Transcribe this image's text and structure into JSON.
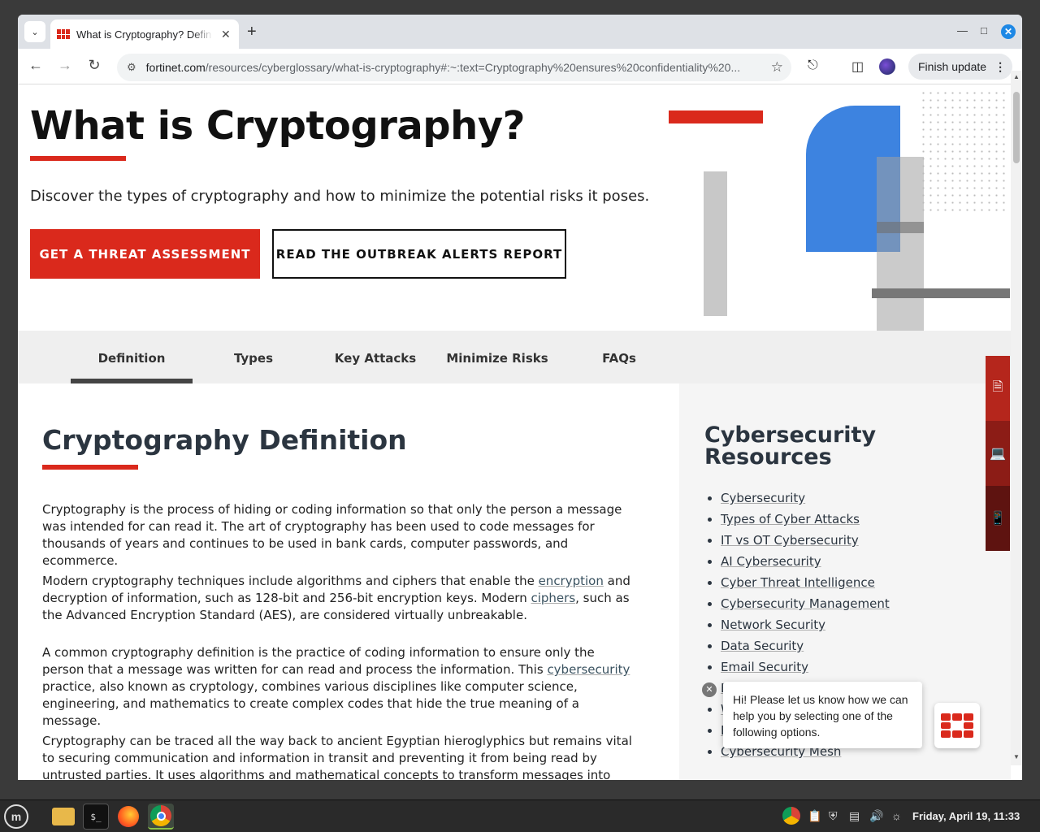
{
  "browser": {
    "tab_title": "What is Cryptography? Defin",
    "url_host": "fortinet.com",
    "url_path": "/resources/cyberglossary/what-is-cryptography#:~:text=Cryptography%20ensures%20confidentiality%20...",
    "finish_update_label": "Finish update"
  },
  "hero": {
    "title": "What is Cryptography?",
    "subtitle": "Discover the types of cryptography and how to minimize the potential risks it poses.",
    "primary_button": "GET A THREAT ASSESSMENT",
    "secondary_button": "READ THE OUTBREAK ALERTS REPORT"
  },
  "tabs": [
    {
      "label": "Definition"
    },
    {
      "label": "Types"
    },
    {
      "label": "Key Attacks"
    },
    {
      "label": "Minimize Risks"
    },
    {
      "label": "FAQs"
    }
  ],
  "section": {
    "title": "Cryptography Definition",
    "p1": "Cryptography is the process of hiding or coding information so that only the person a message was intended for can read it. The art of cryptography has been used to code messages for thousands of years and continues to be used in bank cards, computer passwords, and ecommerce.",
    "p2_a": "Modern cryptography techniques include algorithms and ciphers that enable the ",
    "p2_link1": "encryption",
    "p2_b": " and decryption of information, such as 128-bit and 256-bit encryption keys. Modern ",
    "p2_link2": "ciphers",
    "p2_c": ", such as the Advanced Encryption Standard (AES), are considered virtually unbreakable.",
    "p3_a": "A common cryptography definition is the practice of coding information to ensure only the person that a message was written for can read and process the information. This ",
    "p3_link": "cybersecurity",
    "p3_b": " practice, also known as cryptology, combines various disciplines like computer science, engineering, and mathematics to create complex codes that hide the true meaning of a message.",
    "p4": "Cryptography can be traced all the way back to ancient Egyptian hieroglyphics but remains vital to securing communication and information in transit and preventing it from being read by untrusted parties. It uses algorithms and mathematical concepts to transform messages into difficult-to-decipher"
  },
  "resources": {
    "title_line1": "Cybersecurity",
    "title_line2": "Resources",
    "items": [
      "Cybersecurity",
      "Types of Cyber Attacks",
      "IT vs OT Cybersecurity",
      "AI Cybersecurity",
      "Cyber Threat Intelligence",
      "Cybersecurity Management",
      "Network Security",
      "Data Security",
      "Email Security",
      "E",
      "W",
      "E",
      "Cybersecurity Mesh"
    ]
  },
  "chat": {
    "message": "Hi! Please let us know how we can help you by selecting one of the following options."
  },
  "taskbar": {
    "clock": "Friday, April 19, 11:33"
  },
  "colors": {
    "brand_red": "#da291c",
    "heading": "#2b3540",
    "graphic_blue": "#3d83e0"
  }
}
